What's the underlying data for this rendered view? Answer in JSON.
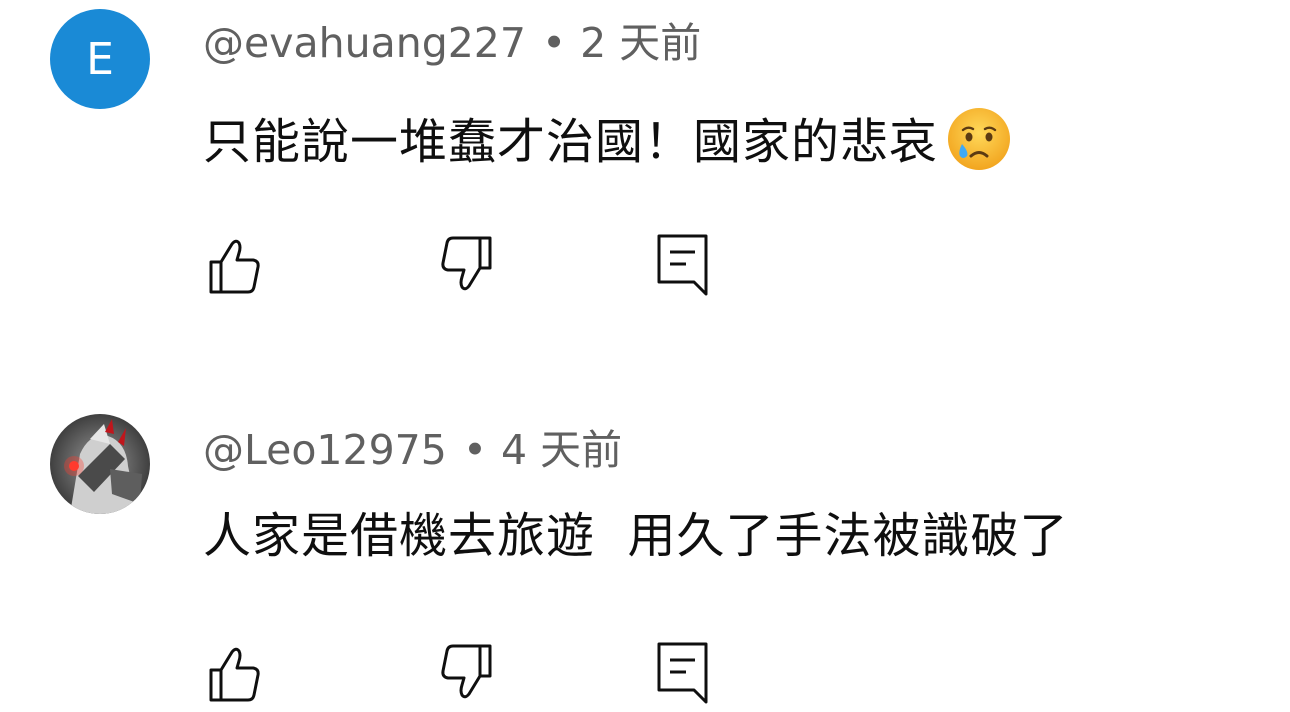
{
  "comments": [
    {
      "avatar_letter": "E",
      "avatar_color": "#1a8ad6",
      "author": "@evahuang227",
      "separator": "•",
      "time": "2 天前",
      "text": "只能說一堆蠢才治國！國家的悲哀",
      "emoji": "crying-face-icon",
      "actions": [
        "thumbs-up-icon",
        "thumbs-down-icon",
        "reply-icon"
      ]
    },
    {
      "avatar_letter": "",
      "avatar_image": "dark-armored-character-avatar",
      "author": "@Leo12975",
      "separator": "•",
      "time": "4 天前",
      "text": "人家是借機去旅遊  用久了手法被識破了",
      "actions": [
        "thumbs-up-icon",
        "thumbs-down-icon",
        "reply-icon"
      ]
    }
  ],
  "colors": {
    "meta_text": "#606060",
    "body_text": "#0f0f0f",
    "icon": "#0f0f0f"
  }
}
